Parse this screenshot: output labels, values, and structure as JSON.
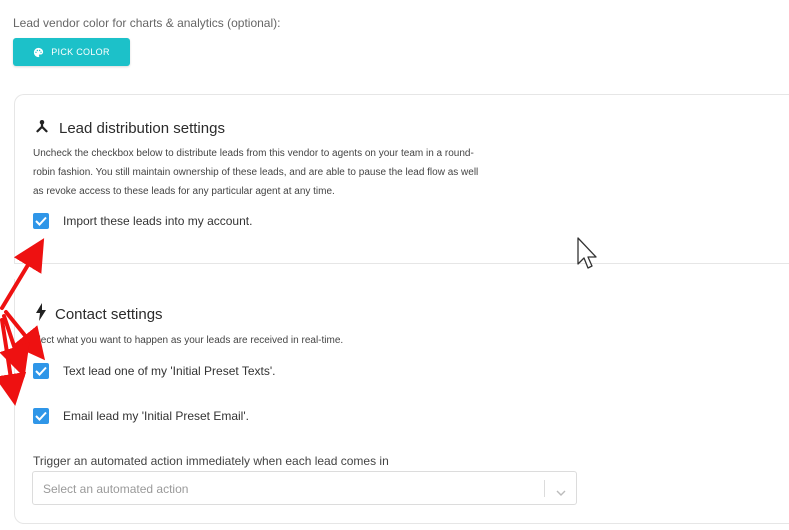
{
  "vendor_color": {
    "label": "Lead vendor color for charts & analytics (optional):",
    "button_label": "PICK COLOR",
    "button_icon": "palette-icon",
    "accent": "#1cc1c9"
  },
  "lead_distribution": {
    "title": "Lead distribution settings",
    "icon": "hub-icon",
    "description_lines": [
      "Uncheck the checkbox below to distribute leads from this vendor to agents on your team in a round-",
      "robin fashion. You still maintain ownership of these leads, and are able to pause the lead flow as well",
      "as revoke access to these leads for any particular agent at any time."
    ],
    "import_checkbox": {
      "label": "Import these leads into my account.",
      "checked": true
    }
  },
  "contact_settings": {
    "title": "Contact settings",
    "icon": "bolt-icon",
    "description": "elect what you want to happen as your leads are received in real-time.",
    "checkboxes": [
      {
        "label": "Text lead one of my 'Initial Preset Texts'.",
        "checked": true
      },
      {
        "label": "Email lead my 'Initial Preset Email'.",
        "checked": true
      }
    ],
    "trigger_label": "Trigger an automated action immediately when each lead comes in",
    "select_placeholder": "Select an automated action"
  },
  "colors": {
    "checkbox": "#2f96e8",
    "annotation_arrows": "#ee1111"
  }
}
